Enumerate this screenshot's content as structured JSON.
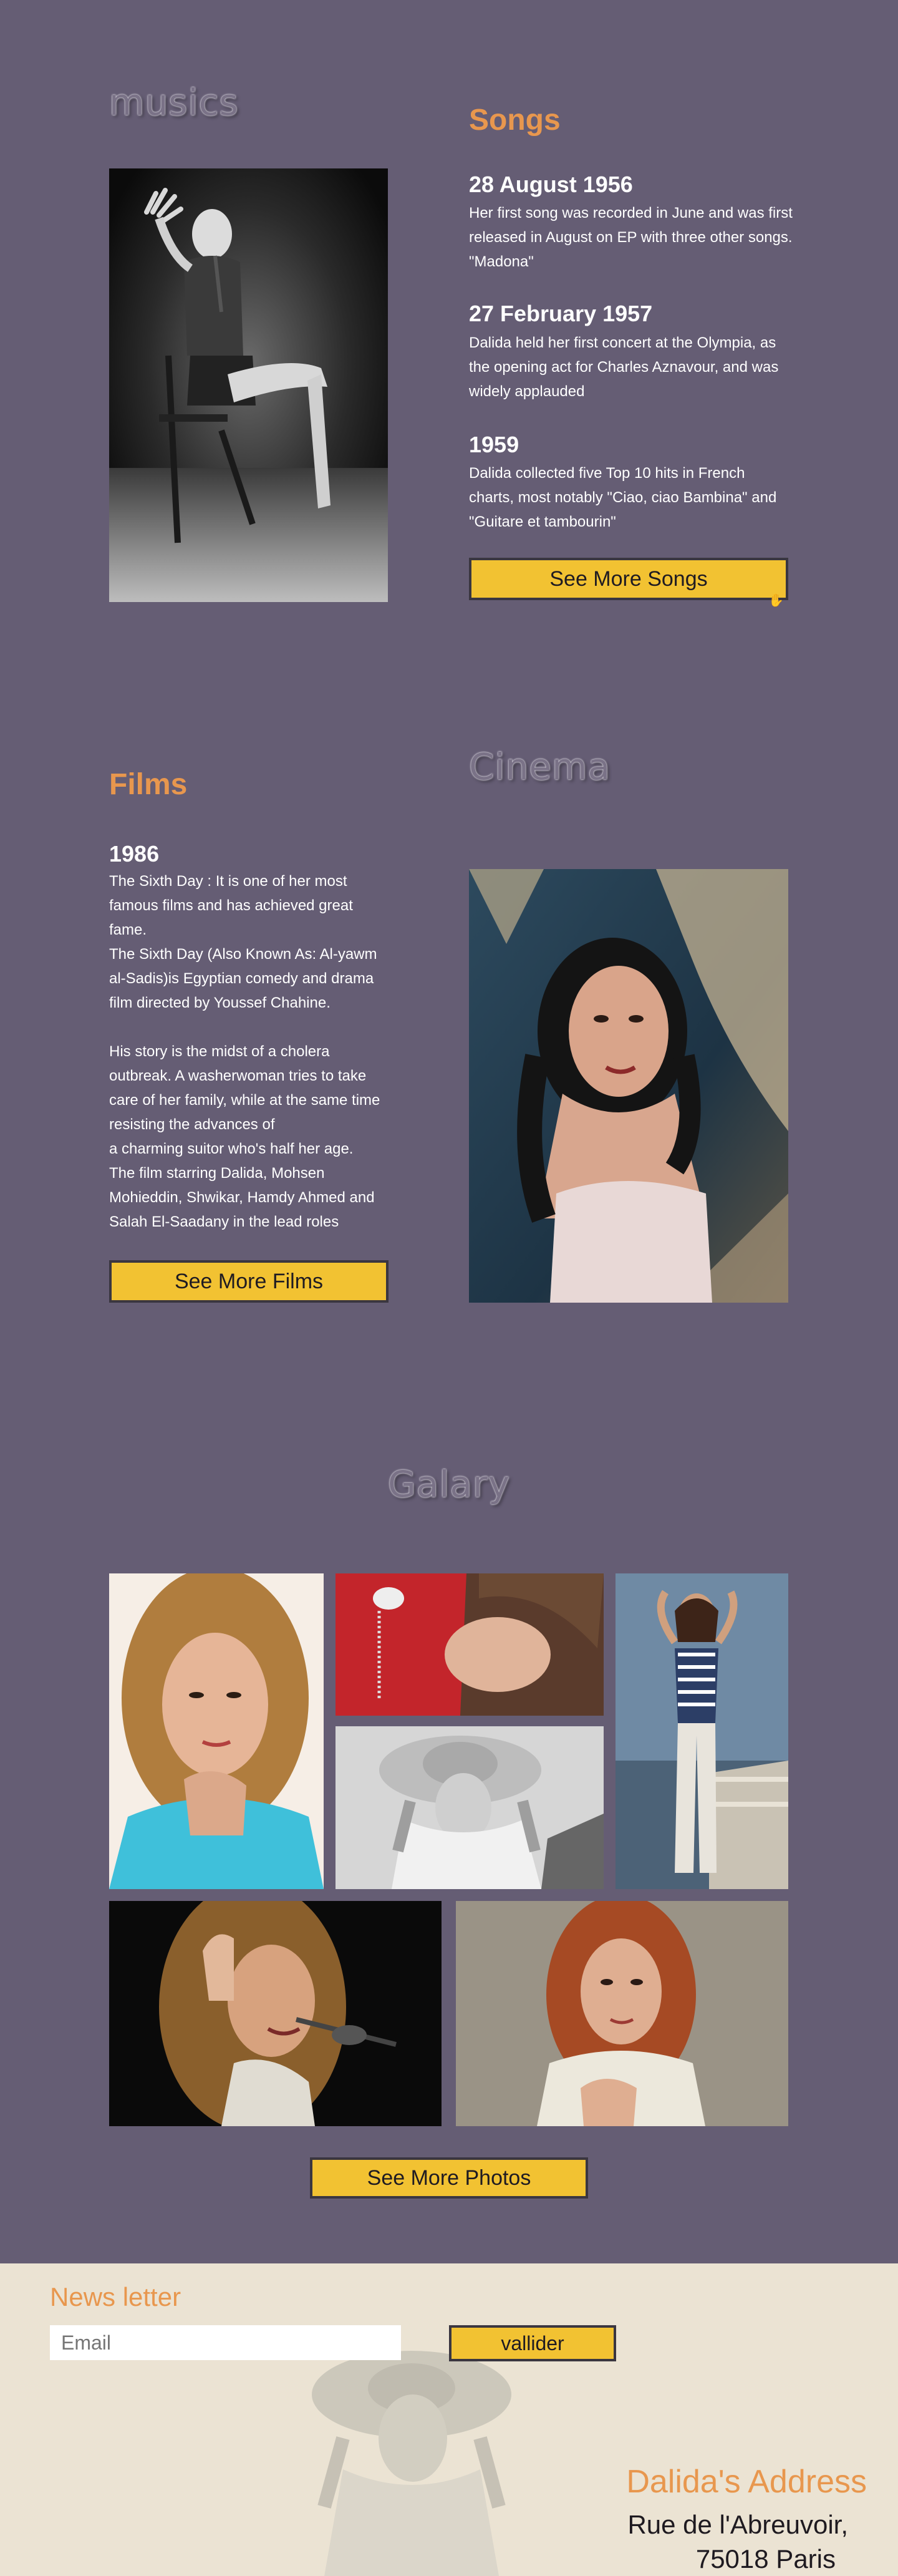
{
  "music": {
    "heading": "musics",
    "songs_heading": "Songs",
    "entries": [
      {
        "date": "28 August 1956",
        "text": "Her first song was recorded in June and was first released in August on EP with three other songs. \"Madona\""
      },
      {
        "date": "27 February 1957",
        "text": "Dalida held her first concert at the Olympia, as the opening act for Charles Aznavour, and was widely applauded"
      },
      {
        "date": "1959",
        "text": "Dalida collected five Top 10 hits in French charts, most notably \"Ciao, ciao Bambina\" and \"Guitare et tambourin\""
      }
    ],
    "button": "See More Songs"
  },
  "films": {
    "heading": "Films",
    "cinema_heading": "Cinema",
    "year": "1986",
    "p1": "The Sixth Day : It is one of her most famous films and has achieved great fame.",
    "p2": "The Sixth Day (Also Known As: Al-yawm al-Sadis)is Egyptian comedy and drama film directed by Youssef Chahine.",
    "p3": "His story is the midst of a cholera outbreak. A washerwoman tries to take care of her family, while at the same time resisting the advances of",
    "p4": "a charming suitor who's half her age.",
    "p5": "The film starring Dalida, Mohsen Mohieddin, Shwikar, Hamdy Ahmed and Salah El-Saadany in the lead roles",
    "button": "See More Films"
  },
  "gallery": {
    "heading": "Galary",
    "button": "See More Photos"
  },
  "footer": {
    "newsletter_title": "News letter",
    "email_placeholder": "Email",
    "submit_label": "vallider",
    "address_title": "Dalida's Address",
    "address_line1": "Rue de l'Abreuvoir,",
    "address_line2": "75018 Paris"
  },
  "colors": {
    "background": "#655d74",
    "accent_orange": "#e8974e",
    "button_yellow": "#f2c232",
    "footer_bg": "#ebe3d3"
  }
}
